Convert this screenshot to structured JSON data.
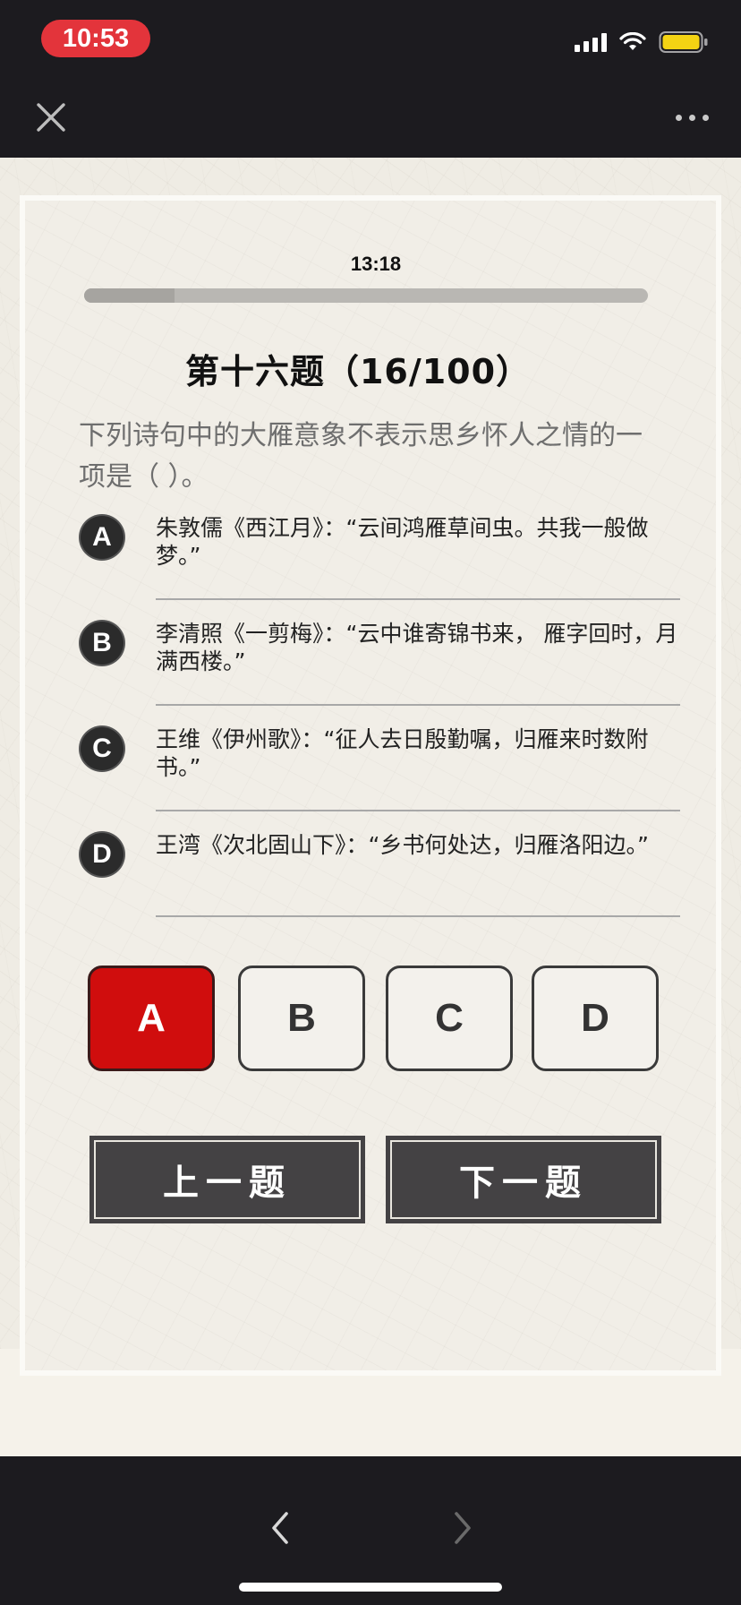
{
  "status_bar": {
    "time": "10:53"
  },
  "quiz": {
    "timer": "13:18",
    "progress": 0.16,
    "title": "第十六题（16/100）",
    "question": "下列诗句中的大雁意象不表示思乡怀人之情的一项是（ ）。",
    "options": [
      {
        "letter": "A",
        "text": "朱敦儒《西江月》：“云间鸿雁草间虫。共我一般做梦。”"
      },
      {
        "letter": "B",
        "text": "李清照《一剪梅》：“云中谁寄锦书来， 雁字回时，月满西楼。”"
      },
      {
        "letter": "C",
        "text": "王维《伊州歌》：“征人去日殷勤嘱，归雁来时数附书。”"
      },
      {
        "letter": "D",
        "text": "王湾《次北固山下》：“乡书何处达，归雁洛阳边。”"
      }
    ],
    "answer_buttons": [
      "A",
      "B",
      "C",
      "D"
    ],
    "selected": "A",
    "prev_label": "上一题",
    "next_label": "下一题"
  },
  "colors": {
    "selected": "#d00d0d",
    "status_pill": "#e3343b",
    "battery": "#f4d313"
  },
  "icons": {
    "close": "close-icon",
    "more": "more-icon",
    "back": "chevron-left-icon",
    "forward": "chevron-right-icon"
  }
}
